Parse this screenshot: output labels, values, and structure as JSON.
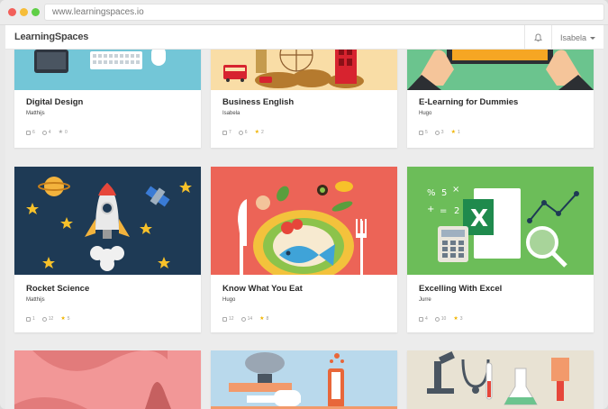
{
  "browser": {
    "url": "www.learningspaces.io"
  },
  "app": {
    "brand": "LearningSpaces",
    "user_name": "Isabela"
  },
  "cards": [
    {
      "title": "Digital Design",
      "author": "Matthijs",
      "comments": "6",
      "members": "4",
      "stars": "0",
      "starred": false,
      "art_bg": "#73c6d7",
      "art": "desktop"
    },
    {
      "title": "Business English",
      "author": "Isabela",
      "comments": "7",
      "members": "6",
      "stars": "2",
      "starred": true,
      "art_bg": "#f9dda6",
      "art": "london"
    },
    {
      "title": "E-Learning for Dummies",
      "author": "Hugo",
      "comments": "5",
      "members": "3",
      "stars": "1",
      "starred": true,
      "art_bg": "#6bc48e",
      "art": "tablet"
    },
    {
      "title": "Rocket Science",
      "author": "Matthijs",
      "comments": "1",
      "members": "12",
      "stars": "5",
      "starred": true,
      "art_bg": "#1e3a55",
      "art": "rocket"
    },
    {
      "title": "Know What You Eat",
      "author": "Hugo",
      "comments": "12",
      "members": "14",
      "stars": "8",
      "starred": true,
      "art_bg": "#ec6457",
      "art": "food"
    },
    {
      "title": "Excelling With Excel",
      "author": "Jurre",
      "comments": "4",
      "members": "10",
      "stars": "3",
      "starred": true,
      "art_bg": "#6cbd59",
      "art": "excel"
    },
    {
      "title": "",
      "author": "",
      "comments": "",
      "members": "",
      "stars": "",
      "starred": false,
      "art_bg": "#f29797",
      "art": "pink"
    },
    {
      "title": "",
      "author": "",
      "comments": "",
      "members": "",
      "stars": "",
      "starred": false,
      "art_bg": "#b9d9ec",
      "art": "brain"
    },
    {
      "title": "",
      "author": "",
      "comments": "",
      "members": "",
      "stars": "",
      "starred": false,
      "art_bg": "#e8e2d3",
      "art": "lab"
    }
  ],
  "icons": {
    "notifications": "bell-icon",
    "comments": "comment-icon",
    "members": "people-icon",
    "stars": "star-icon"
  }
}
